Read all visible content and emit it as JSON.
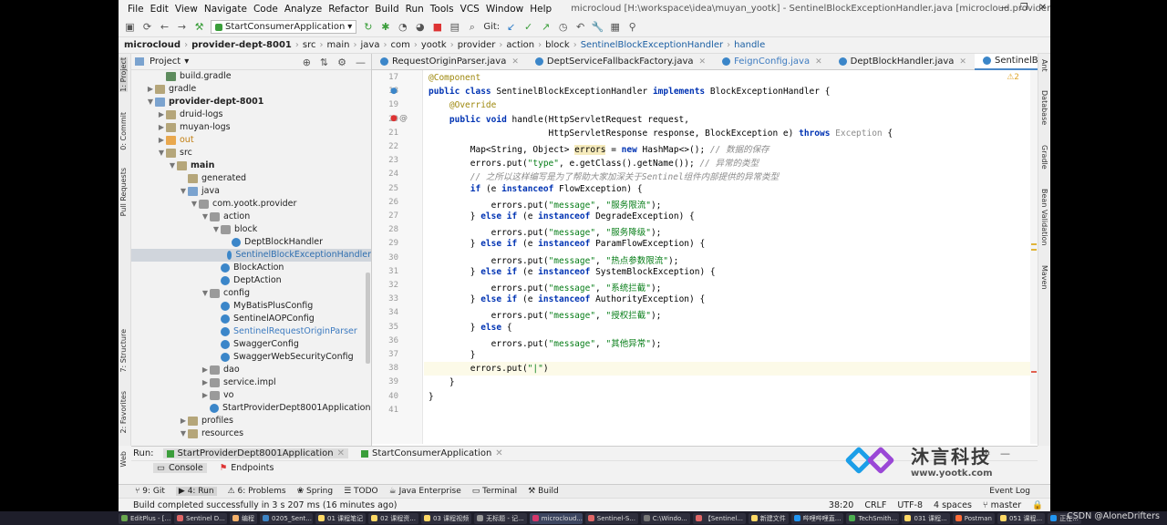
{
  "window": {
    "title": "microcloud [H:\\workspace\\idea\\muyan_yootk] - SentinelBlockExceptionHandler.java [microcloud.provider-dept-8001.main]",
    "menu": [
      "File",
      "Edit",
      "View",
      "Navigate",
      "Code",
      "Analyze",
      "Refactor",
      "Build",
      "Run",
      "Tools",
      "VCS",
      "Window",
      "Help"
    ]
  },
  "toolbar": {
    "run_config": "StartConsumerApplication",
    "git_label": "Git:"
  },
  "breadcrumb": [
    "microcloud",
    "provider-dept-8001",
    "src",
    "main",
    "java",
    "com",
    "yootk",
    "provider",
    "action",
    "block",
    "SentinelBlockExceptionHandler",
    "handle"
  ],
  "left_strip": [
    "1: Project",
    "0: Commit",
    "Pull Requests",
    "7: Structure",
    "2: Favorites",
    "Web"
  ],
  "right_strip": [
    "Ant",
    "Database",
    "Gradle",
    "Bean Validation",
    "Maven"
  ],
  "project": {
    "header": "Project",
    "tree": [
      {
        "label": "build.gradle",
        "depth": 2,
        "icon": "gradle",
        "arrow": ""
      },
      {
        "label": "gradle",
        "depth": 1,
        "icon": "folder",
        "arrow": "▶"
      },
      {
        "label": "provider-dept-8001",
        "depth": 1,
        "icon": "mod",
        "arrow": "▼",
        "bold": true
      },
      {
        "label": "druid-logs",
        "depth": 2,
        "icon": "folder",
        "arrow": "▶"
      },
      {
        "label": "muyan-logs",
        "depth": 2,
        "icon": "folder",
        "arrow": "▶"
      },
      {
        "label": "out",
        "depth": 2,
        "icon": "folder orange",
        "arrow": "▶",
        "color": "orange"
      },
      {
        "label": "src",
        "depth": 2,
        "icon": "folder",
        "arrow": "▼"
      },
      {
        "label": "main",
        "depth": 3,
        "icon": "folder",
        "arrow": "▼",
        "bold": true
      },
      {
        "label": "generated",
        "depth": 4,
        "icon": "folder",
        "arrow": ""
      },
      {
        "label": "java",
        "depth": 4,
        "icon": "folder blue",
        "arrow": "▼"
      },
      {
        "label": "com.yootk.provider",
        "depth": 5,
        "icon": "pkg",
        "arrow": "▼"
      },
      {
        "label": "action",
        "depth": 6,
        "icon": "pkg",
        "arrow": "▼"
      },
      {
        "label": "block",
        "depth": 7,
        "icon": "pkg",
        "arrow": "▼"
      },
      {
        "label": "DeptBlockHandler",
        "depth": 8,
        "icon": "cls",
        "arrow": ""
      },
      {
        "label": "SentinelBlockExceptionHandler",
        "depth": 8,
        "icon": "cls",
        "arrow": "",
        "selected": true
      },
      {
        "label": "BlockAction",
        "depth": 7,
        "icon": "cls",
        "arrow": ""
      },
      {
        "label": "DeptAction",
        "depth": 7,
        "icon": "cls",
        "arrow": ""
      },
      {
        "label": "config",
        "depth": 6,
        "icon": "pkg",
        "arrow": "▼"
      },
      {
        "label": "MyBatisPlusConfig",
        "depth": 7,
        "icon": "cls",
        "arrow": ""
      },
      {
        "label": "SentinelAOPConfig",
        "depth": 7,
        "icon": "cls",
        "arrow": ""
      },
      {
        "label": "SentinelRequestOriginParser",
        "depth": 7,
        "icon": "cls",
        "arrow": "",
        "color": "blue"
      },
      {
        "label": "SwaggerConfig",
        "depth": 7,
        "icon": "cls",
        "arrow": ""
      },
      {
        "label": "SwaggerWebSecurityConfig",
        "depth": 7,
        "icon": "cls",
        "arrow": ""
      },
      {
        "label": "dao",
        "depth": 6,
        "icon": "pkg",
        "arrow": "▶"
      },
      {
        "label": "service.impl",
        "depth": 6,
        "icon": "pkg",
        "arrow": "▶"
      },
      {
        "label": "vo",
        "depth": 6,
        "icon": "pkg",
        "arrow": "▶"
      },
      {
        "label": "StartProviderDept8001Application",
        "depth": 6,
        "icon": "cls",
        "arrow": ""
      },
      {
        "label": "profiles",
        "depth": 4,
        "icon": "folder",
        "arrow": "▶"
      },
      {
        "label": "resources",
        "depth": 4,
        "icon": "folder",
        "arrow": "▼"
      }
    ]
  },
  "editor": {
    "tabs": [
      {
        "label": "RequestOriginParser.java",
        "active": false
      },
      {
        "label": "DeptServiceFallbackFactory.java",
        "active": false
      },
      {
        "label": "FeignConfig.java",
        "active": false,
        "blue": true
      },
      {
        "label": "DeptBlockHandler.java",
        "active": false
      },
      {
        "label": "SentinelBlockExceptionHandler.java",
        "active": true
      }
    ],
    "warning_count": "⚠2",
    "lines": [
      {
        "n": "17",
        "html": "<span class=\"ann\">@Component</span>"
      },
      {
        "n": "18",
        "html": "<span class=\"kw\">public class</span> SentinelBlockExceptionHandler <span class=\"kw\">implements</span> BlockExceptionHandler {"
      },
      {
        "n": "19",
        "html": "    <span class=\"ann\">@Override</span>"
      },
      {
        "n": "20",
        "html": "    <span class=\"kw\">public void</span> handle(HttpServletRequest request,"
      },
      {
        "n": "21",
        "html": "                       HttpServletResponse response, BlockException e) <span class=\"kw\">throws</span> <span class=\"gray\">Exception</span> {"
      },
      {
        "n": "22",
        "html": "        Map&lt;String, Object&gt; <span class=\"hl\">errors</span> = <span class=\"kw\">new</span> HashMap&lt;&gt;(); <span class=\"cmt\">// 数据的保存</span>"
      },
      {
        "n": "23",
        "html": "        errors.put(<span class=\"str\">\"type\"</span>, e.getClass().getName()); <span class=\"cmt\">// 异常的类型</span>"
      },
      {
        "n": "24",
        "html": "        <span class=\"cmt\">// 之所以这样编写是为了帮助大家加深关于Sentinel组件内部提供的异常类型</span>"
      },
      {
        "n": "25",
        "html": "        <span class=\"kw\">if</span> (e <span class=\"kw\">instanceof</span> FlowException) {"
      },
      {
        "n": "26",
        "html": "            errors.put(<span class=\"str\">\"message\"</span>, <span class=\"str\">\"服务限流\"</span>);"
      },
      {
        "n": "27",
        "html": "        } <span class=\"kw\">else if</span> (e <span class=\"kw\">instanceof</span> DegradeException) {"
      },
      {
        "n": "28",
        "html": "            errors.put(<span class=\"str\">\"message\"</span>, <span class=\"str\">\"服务降级\"</span>);"
      },
      {
        "n": "29",
        "html": "        } <span class=\"kw\">else if</span> (e <span class=\"kw\">instanceof</span> ParamFlowException) {"
      },
      {
        "n": "30",
        "html": "            errors.put(<span class=\"str\">\"message\"</span>, <span class=\"str\">\"热点参数限流\"</span>);"
      },
      {
        "n": "31",
        "html": "        } <span class=\"kw\">else if</span> (e <span class=\"kw\">instanceof</span> SystemBlockException) {"
      },
      {
        "n": "32",
        "html": "            errors.put(<span class=\"str\">\"message\"</span>, <span class=\"str\">\"系统拦截\"</span>);"
      },
      {
        "n": "33",
        "html": "        } <span class=\"kw\">else if</span> (e <span class=\"kw\">instanceof</span> AuthorityException) {"
      },
      {
        "n": "34",
        "html": "            errors.put(<span class=\"str\">\"message\"</span>, <span class=\"str\">\"授权拦截\"</span>);"
      },
      {
        "n": "35",
        "html": "        } <span class=\"kw\">else</span> {"
      },
      {
        "n": "36",
        "html": "            errors.put(<span class=\"str\">\"message\"</span>, <span class=\"str\">\"其他异常\"</span>);"
      },
      {
        "n": "37",
        "html": "        }"
      },
      {
        "n": "38",
        "html": "        errors.put(<span class=\"str\">\"|\"</span>)"
      },
      {
        "n": "39",
        "html": "    }"
      },
      {
        "n": "40",
        "html": "}"
      },
      {
        "n": "41",
        "html": ""
      }
    ]
  },
  "run_panel": {
    "label": "Run:",
    "tabs": [
      "StartProviderDept8001Application",
      "StartConsumerApplication"
    ],
    "subtabs": [
      "Console",
      "Endpoints"
    ]
  },
  "bottom_tools": [
    "9: Git",
    "4: Run",
    "6: Problems",
    "Spring",
    "TODO",
    "Java Enterprise",
    "Terminal",
    "Build"
  ],
  "event_log": "Event Log",
  "status": {
    "message": "Build completed successfully in 3 s 207 ms (16 minutes ago)",
    "position": "38:20",
    "line_sep": "CRLF",
    "encoding": "UTF-8",
    "indent": "4 spaces",
    "branch": "master"
  },
  "brand": {
    "name": "沐言科技",
    "url": "www.yootk.com"
  },
  "taskbar": [
    "EditPlus - [...",
    "Sentinel D...",
    "编程",
    "0205_Sent...",
    "01 课程笔记",
    "02 课程资...",
    "03 课程视频",
    "无标题 - 记...",
    "microcloud...",
    "Sentinel-S...",
    "C:\\Windo...",
    "【Sentinel...",
    "新建文件",
    "哔哩哔哩直...",
    "TechSmith...",
    "031 课程...",
    "Postman",
    "051 课程...",
    "正在..."
  ],
  "watermark": "CSDN @AloneDrifters"
}
